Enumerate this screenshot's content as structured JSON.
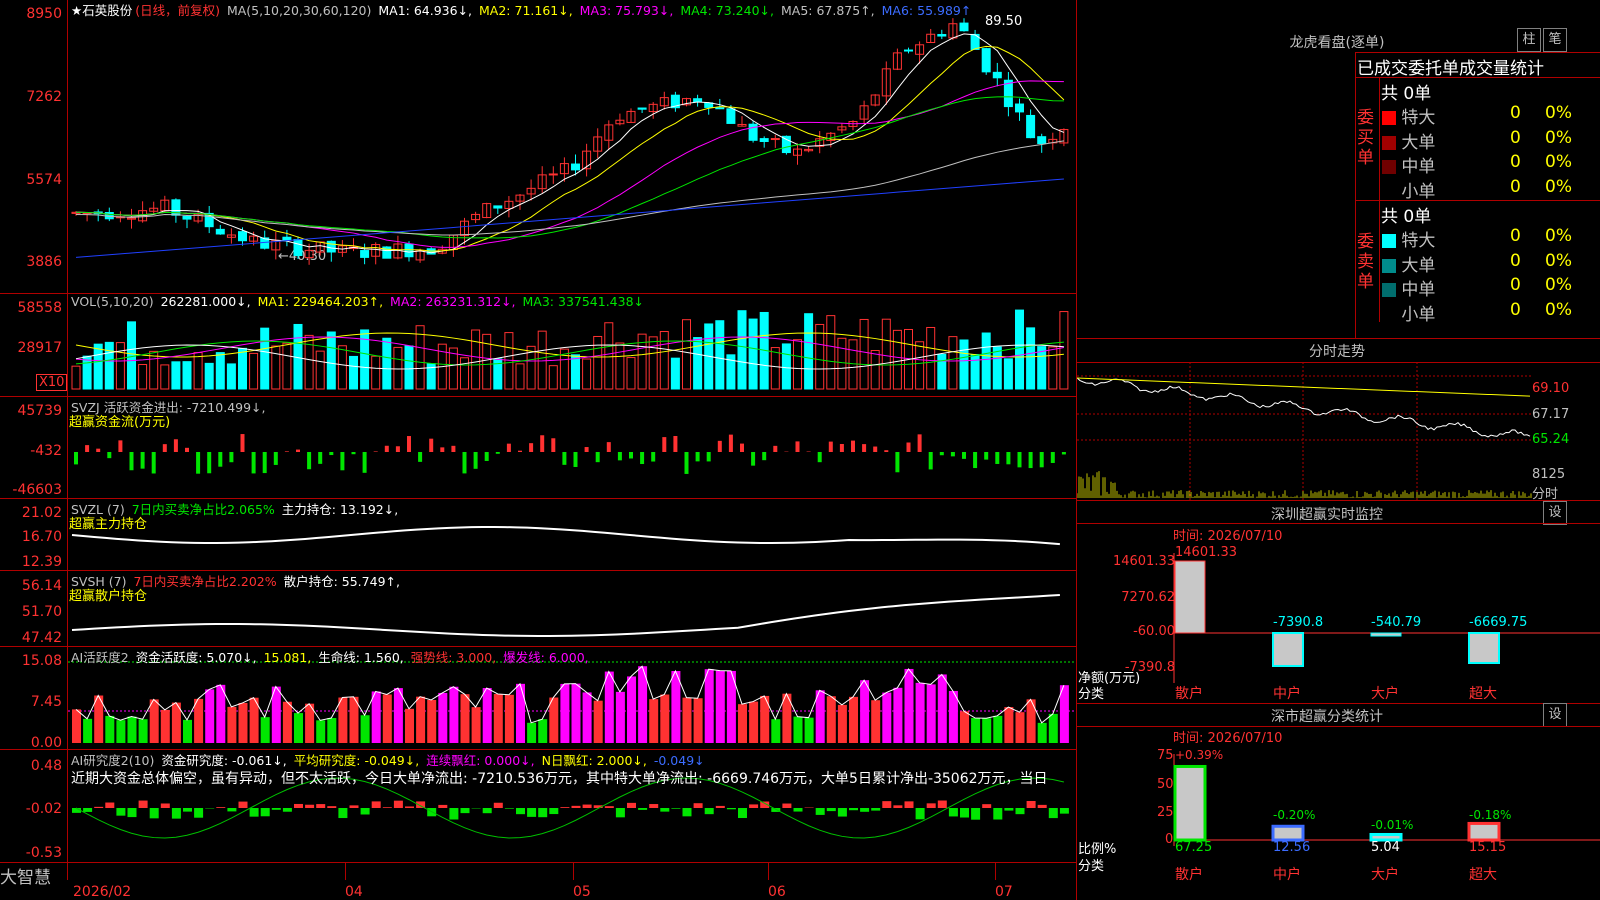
{
  "stock": {
    "title": "★石英股份",
    "mode": "(日线，前复权)",
    "ma_label": "MA(5,10,20,30,60,120)",
    "ma1": "MA1: 64.936↓,",
    "ma2": "MA2: 71.161↓,",
    "ma3": "MA3: 75.793↓,",
    "ma4": "MA4: 73.240↓,",
    "ma5": "MA5: 67.875↑,",
    "ma6": "MA6: 55.989↑",
    "high_mark": "89.50",
    "low_mark": "←40.30",
    "y_ticks": [
      "8950",
      "7262",
      "5574",
      "3886"
    ]
  },
  "vol": {
    "label": "VOL(5,10,20)",
    "value": "262281.000↓,",
    "ma1": "MA1: 229464.203↑,",
    "ma2": "MA2: 263231.312↓,",
    "ma3": "MA3: 337541.438↓",
    "y_ticks": [
      "58558",
      "28917"
    ],
    "unit": "X10"
  },
  "svzj": {
    "label": "SVZJ  活跃资金进出: -7210.499↓,",
    "sub": "超赢资金流(万元)",
    "y_ticks": [
      "45739",
      "-432",
      "-46603"
    ]
  },
  "svzl": {
    "label": "SVZL (7)",
    "ratio": "7日内买卖净占比2.065%",
    "hold": "主力持仓: 13.192↓,",
    "sub": "超赢主力持仓",
    "y_ticks": [
      "21.02",
      "16.70",
      "12.39"
    ]
  },
  "svsh": {
    "label": "SVSH (7)",
    "ratio": "7日内买卖净占比2.202%",
    "hold": "散户持仓: 55.749↑,",
    "sub": "超赢散户持仓",
    "y_ticks": [
      "56.14",
      "51.70",
      "47.42"
    ]
  },
  "ai_active": {
    "label": "AI活跃度2",
    "v1": "资金活跃度: 5.070↓,",
    "v2": "15.081,",
    "v3": "生命线: 1.560,",
    "v4": "强势线: 3.000,",
    "v5": "爆发线: 6.000,",
    "y_ticks": [
      "15.08",
      "7.45",
      "0.00"
    ]
  },
  "ai_research": {
    "label": "AI研究度2(10)",
    "v1": "资金研究度: -0.061↓,",
    "v2": "平均研究度: -0.049↓,",
    "v3": "连续飘红: 0.000↓,",
    "v4": "N日飘红: 2.000↓,",
    "v5": "-0.049↓",
    "comment": "近期大资金总体偏空，虽有异动，但不太活跃，今日大单净流出: -7210.536万元，其中特大单净流出: -6669.746万元，大单5日累计净出-35062万元，当日",
    "y_ticks": [
      "0.48",
      "-0.02",
      "-0.53"
    ]
  },
  "bottom": {
    "brand": "大智慧",
    "dates": [
      "2026/02",
      "04",
      "05",
      "06",
      "07"
    ]
  },
  "dragon": {
    "title": "龙虎看盘(逐单)",
    "btn1": "柱",
    "btn2": "笔",
    "subtitle": "已成交委托单成交量统计",
    "buy_label": "委买单",
    "sell_label": "委卖单",
    "buy_total": "共 0单",
    "sell_total": "共 0单",
    "buy_rows": [
      {
        "name": "特大",
        "count": "0",
        "pct": "0%",
        "color": "#ff0000"
      },
      {
        "name": "大单",
        "count": "0",
        "pct": "0%",
        "color": "#a00000"
      },
      {
        "name": "中单",
        "count": "0",
        "pct": "0%",
        "color": "#700000"
      },
      {
        "name": "小单",
        "count": "0",
        "pct": "0%",
        "color": "#000000"
      }
    ],
    "sell_rows": [
      {
        "name": "特大",
        "count": "0",
        "pct": "0%",
        "color": "#00ffff"
      },
      {
        "name": "大单",
        "count": "0",
        "pct": "0%",
        "color": "#008c8c"
      },
      {
        "name": "中单",
        "count": "0",
        "pct": "0%",
        "color": "#006e6e"
      },
      {
        "name": "小单",
        "count": "0",
        "pct": "0%",
        "color": "#000000"
      }
    ]
  },
  "intraday": {
    "title": "分时走势",
    "y_ticks": [
      "69.10",
      "67.17",
      "65.24",
      "8125",
      "分时"
    ]
  },
  "sz_monitor": {
    "title": "深圳超赢实时监控",
    "btn": "设",
    "time": "时间: 2026/07/10",
    "y_ticks": [
      "14601.33",
      "7270.62",
      "-60.00",
      "-7390.8"
    ],
    "bar_labels": [
      "14601.33",
      "-7390.8",
      "-540.79",
      "-6669.75"
    ],
    "net_label": "净额(万元)",
    "cat_label": "分类",
    "cats": [
      "散户",
      "中户",
      "大户",
      "超大"
    ]
  },
  "sz_class": {
    "title": "深市超赢分类统计",
    "btn": "设",
    "time": "时间: 2026/07/10",
    "y_ticks": [
      "75",
      "50",
      "25",
      "0"
    ],
    "top_labels": [
      "+0.39%",
      "-0.20%",
      "-0.01%",
      "-0.18%"
    ],
    "values": [
      "67.25",
      "12.56",
      "5.04",
      "15.15"
    ],
    "ratio_label": "比例%",
    "cat_label": "分类",
    "cats": [
      "散户",
      "中户",
      "大户",
      "超大"
    ]
  },
  "colors": {
    "up": "#ff3232",
    "down": "#00ffff",
    "grid": "#b00000",
    "green": "#00e600",
    "magenta": "#ff00ff"
  }
}
